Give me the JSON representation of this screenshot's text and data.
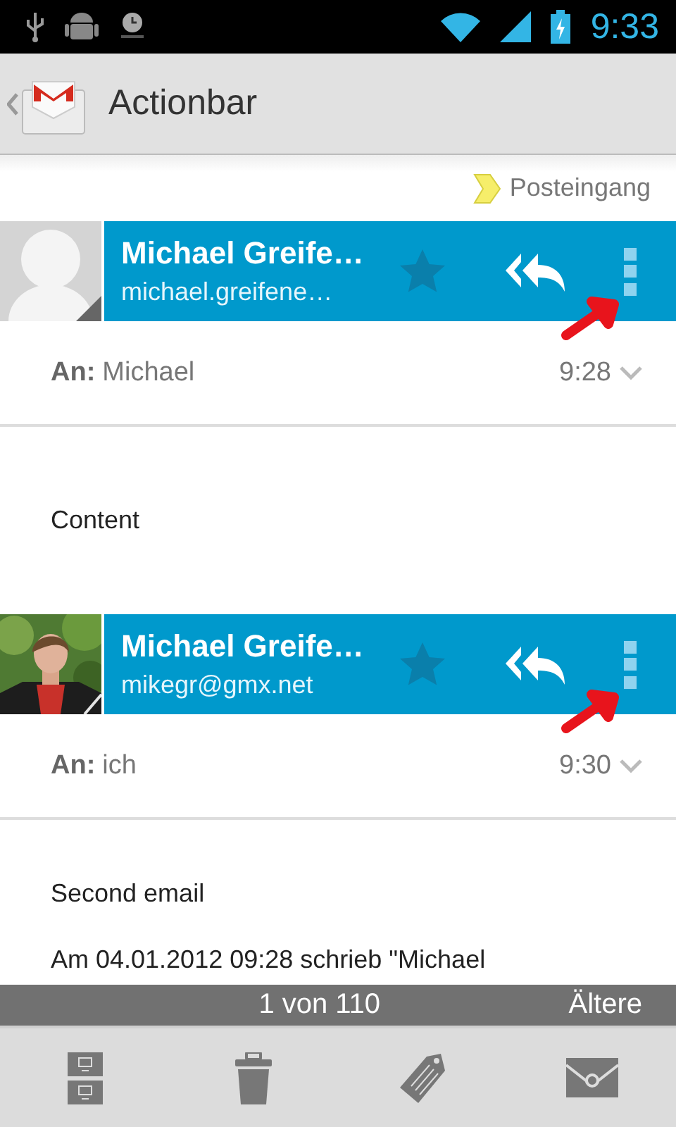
{
  "status_bar": {
    "time": "9:33"
  },
  "action_bar": {
    "title": "Actionbar"
  },
  "folder_label": {
    "text": "Posteingang"
  },
  "messages": [
    {
      "avatar": {
        "kind": "placeholder"
      },
      "sender": "Michael Greife…",
      "email": "michael.greifene…",
      "starred": false,
      "to_label": "An:",
      "to": "Michael",
      "time": "9:28",
      "body": [
        "Content"
      ]
    },
    {
      "sender": "Michael Greife…",
      "email": "mikegr@gmx.net",
      "starred": false,
      "to_label": "An:",
      "to": "ich",
      "time": "9:30",
      "body": [
        "Second email",
        "Am 04.01.2012 09:28 schrieb \"Michael"
      ]
    }
  ],
  "pager": {
    "position": "1 von 110",
    "older": "Ältere"
  },
  "bottom_actions": [
    {
      "kind": "archive"
    },
    {
      "kind": "delete"
    },
    {
      "kind": "label"
    },
    {
      "kind": "unread"
    }
  ]
}
